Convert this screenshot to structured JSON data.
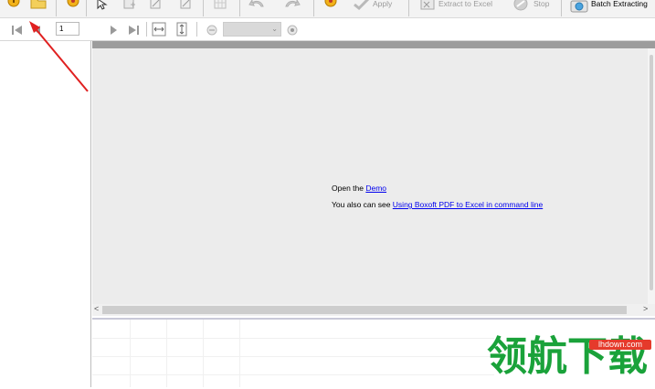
{
  "toolbar": {
    "apply_label": "Apply",
    "extract_label": "Extract to Excel",
    "stop_label": "Stop",
    "batch_label": "Batch Extracting"
  },
  "navigation": {
    "page_number": "1"
  },
  "viewer": {
    "line1_prefix": "Open the ",
    "line1_link": "Demo",
    "line2_prefix": "You also can see ",
    "line2_link": "Using  Boxoft PDF to Excel in command line"
  },
  "scrollbar": {
    "left_arrow": "<",
    "right_arrow": ">"
  },
  "watermark": {
    "text": "领航下载",
    "badge": "lhdown.com"
  },
  "colors": {
    "accent_arrow": "#e02020",
    "link": "#0000ee",
    "watermark_green": "#1aa23a",
    "watermark_red": "#e53a2b"
  }
}
